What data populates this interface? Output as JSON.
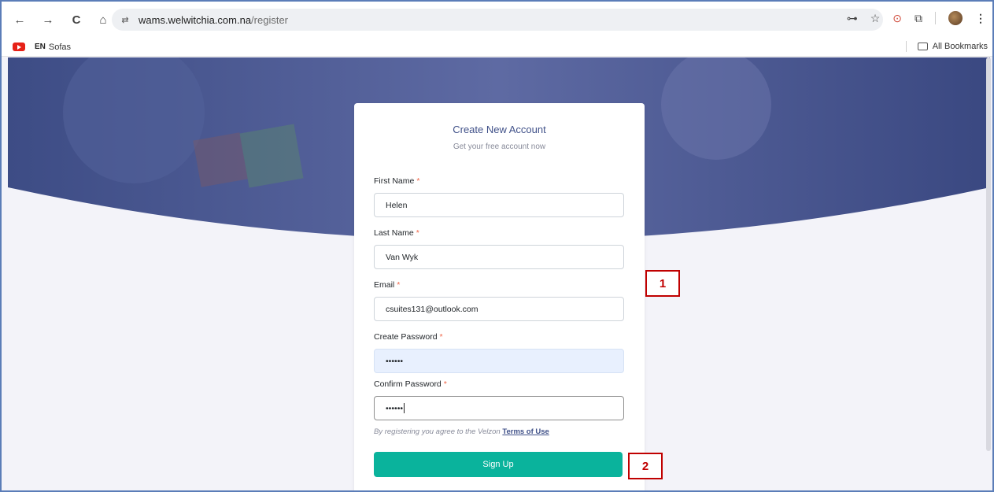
{
  "browser": {
    "url_host": "wams.welwitchia.com.na",
    "url_path": "/register",
    "nav_icons": [
      "back-icon",
      "forward-icon",
      "reload-icon",
      "home-icon"
    ],
    "back_glyph": "←",
    "forward_glyph": "→",
    "reload_glyph": "C",
    "home_glyph": "⌂",
    "site_glyph": "⇄",
    "key_glyph": "⊶",
    "star_glyph": "☆",
    "lens_glyph": "⊙",
    "ext_glyph": "⧉",
    "menu_glyph": "⋮"
  },
  "bookmarks": {
    "lang_badge": "EN",
    "item": "Sofas",
    "all_bookmarks": "All Bookmarks"
  },
  "form": {
    "title": "Create New Account",
    "subtitle": "Get your free account now",
    "required_mark": "*",
    "first_name_label": "First Name",
    "first_name_value": "Helen",
    "last_name_label": "Last Name",
    "last_name_value": "Van Wyk",
    "email_label": "Email",
    "email_value": "csuites131@outlook.com",
    "password_label": "Create Password",
    "password_value": "••••••",
    "confirm_label": "Confirm Password",
    "confirm_value": "••••••",
    "terms_text": "By registering you agree to the Velzon ",
    "terms_link": "Terms of Use",
    "submit_label": "Sign Up"
  },
  "annotations": [
    "1",
    "2"
  ],
  "colors": {
    "hero": "#405189",
    "accent": "#0ab39c",
    "annotation": "#c00000",
    "required": "#f06548"
  }
}
